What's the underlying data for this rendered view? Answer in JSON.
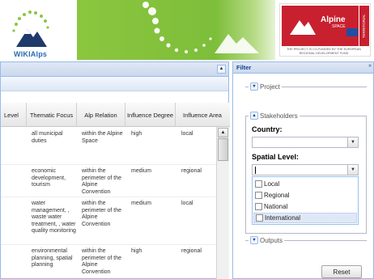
{
  "banner": {
    "wiki_logo_text": "WIKIAlps",
    "alpine_word": "Alpine",
    "alpine_space": "SPACE",
    "cooperation": "TERRITORIAL COOPERATION",
    "funded_text": "THE PROJECT IS CO-FUNDED BY THE EUROPEAN REGIONAL DEVELOPMENT FUND",
    "colors": {
      "green": "#8cc63f",
      "red": "#c8202f",
      "blue": "#2a6bb5"
    }
  },
  "main": {
    "columns": [
      "Level",
      "Thematic Focus",
      "Alp Relation",
      "Influence Degree",
      "Influence Area"
    ],
    "rows": [
      {
        "thematic": "all municipal duties",
        "alp": "within the Alpine Space",
        "degree": "high",
        "area": "local"
      },
      {
        "thematic": "economic development, tourism",
        "alp": "within the perimeter of the Alpine Convention",
        "degree": "medium",
        "area": "regional"
      },
      {
        "thematic": "water management, , waste water treatment, , water quality monitoring",
        "alp": "within the perimeter of the Alpine Convention",
        "degree": "medium",
        "area": "local"
      },
      {
        "thematic": "environmental planning, spatial planning",
        "alp": "within the perimeter of the Alpine Convention",
        "degree": "high",
        "area": "regional"
      }
    ]
  },
  "filter": {
    "title": "Filter",
    "collapse_glyph": "»",
    "sections": {
      "project": "Project",
      "stakeholders": "Stakeholders",
      "outputs": "Outputs"
    },
    "country_label": "Country:",
    "spatial_label": "Spatial Level:",
    "options": [
      "Local",
      "Regional",
      "National",
      "International"
    ],
    "reset_label": "Reset"
  },
  "icons": {
    "collapse": "collapse-right-icon",
    "expand": "expand-icon",
    "dropdown": "chevron-down-icon"
  }
}
